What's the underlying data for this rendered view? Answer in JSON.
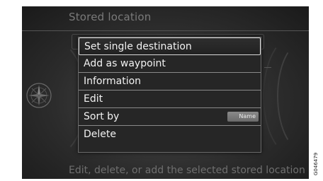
{
  "header": {
    "title": "Stored location"
  },
  "menu": {
    "items": [
      {
        "label": "Set single destination",
        "selected": true
      },
      {
        "label": "Add as waypoint"
      },
      {
        "label": "Information"
      },
      {
        "label": "Edit"
      },
      {
        "label": "Sort by",
        "badge": "Name"
      },
      {
        "label": "Delete"
      }
    ]
  },
  "footer": {
    "text": "Edit, delete, or add the selected stored location"
  },
  "figure_code": "G046479",
  "icons": {
    "compass": "compass-rose-icon"
  }
}
